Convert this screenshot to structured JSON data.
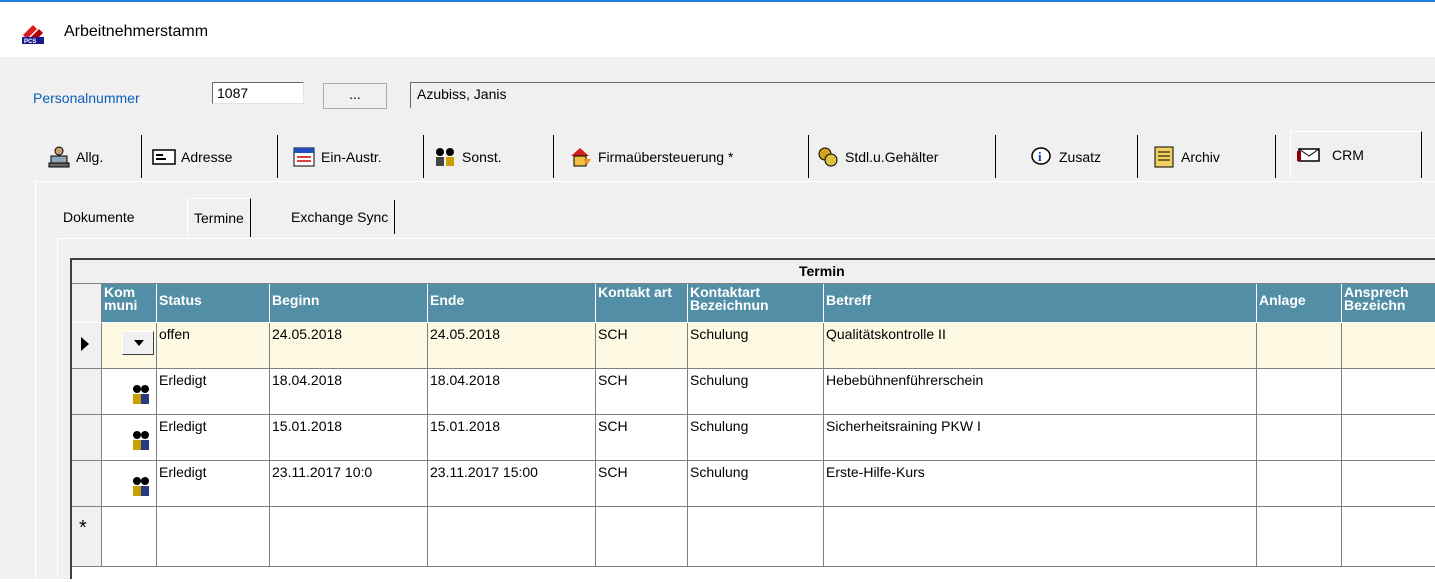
{
  "window": {
    "title": "Arbeitnehmerstamm"
  },
  "employee": {
    "personalnummer_label": "Personalnummer",
    "personalnummer_value": "1087",
    "browse_label": "...",
    "name": "Azubiss, Janis"
  },
  "main_tabs": [
    {
      "label": "Allg.",
      "icon": "person-computer-icon"
    },
    {
      "label": "Adresse",
      "icon": "address-card-icon"
    },
    {
      "label": "Ein-Austr.",
      "icon": "calendar-icon"
    },
    {
      "label": "Sonst.",
      "icon": "people-icon"
    },
    {
      "label": "Firmaübersteuerung *",
      "icon": "house-arrow-icon"
    },
    {
      "label": "Stdl.u.Gehälter",
      "icon": "money-icon"
    },
    {
      "label": "Zusatz",
      "icon": "info-icon"
    },
    {
      "label": "Archiv",
      "icon": "archive-icon"
    },
    {
      "label": "CRM",
      "icon": "crm-icon"
    }
  ],
  "sub_tabs": [
    "Dokumente",
    "Termine",
    "Exchange Sync"
  ],
  "grid": {
    "group_header": "Termin",
    "columns": [
      "Kom muni",
      "Status",
      "Beginn",
      "Ende",
      "Kontakt art",
      "Kontaktart Bezeichnun",
      "Betreff",
      "Anlage",
      "Ansprech Bezeichn"
    ],
    "rows": [
      {
        "status": "offen",
        "beginn": "24.05.2018",
        "ende": "24.05.2018",
        "kontaktart": "SCH",
        "bezeichnung": "Schulung",
        "betreff": "Qualitätskontrolle II"
      },
      {
        "status": "Erledigt",
        "beginn": "18.04.2018",
        "ende": "18.04.2018",
        "kontaktart": "SCH",
        "bezeichnung": "Schulung",
        "betreff": "Hebebühnenführerschein"
      },
      {
        "status": "Erledigt",
        "beginn": "15.01.2018",
        "ende": "15.01.2018",
        "kontaktart": "SCH",
        "bezeichnung": "Schulung",
        "betreff": "Sicherheitsraining PKW I"
      },
      {
        "status": "Erledigt",
        "beginn": "23.11.2017 10:0",
        "ende": "23.11.2017 15:00",
        "kontaktart": "SCH",
        "bezeichnung": "Schulung",
        "betreff": "Erste-Hilfe-Kurs"
      }
    ],
    "new_row_marker": "*"
  }
}
